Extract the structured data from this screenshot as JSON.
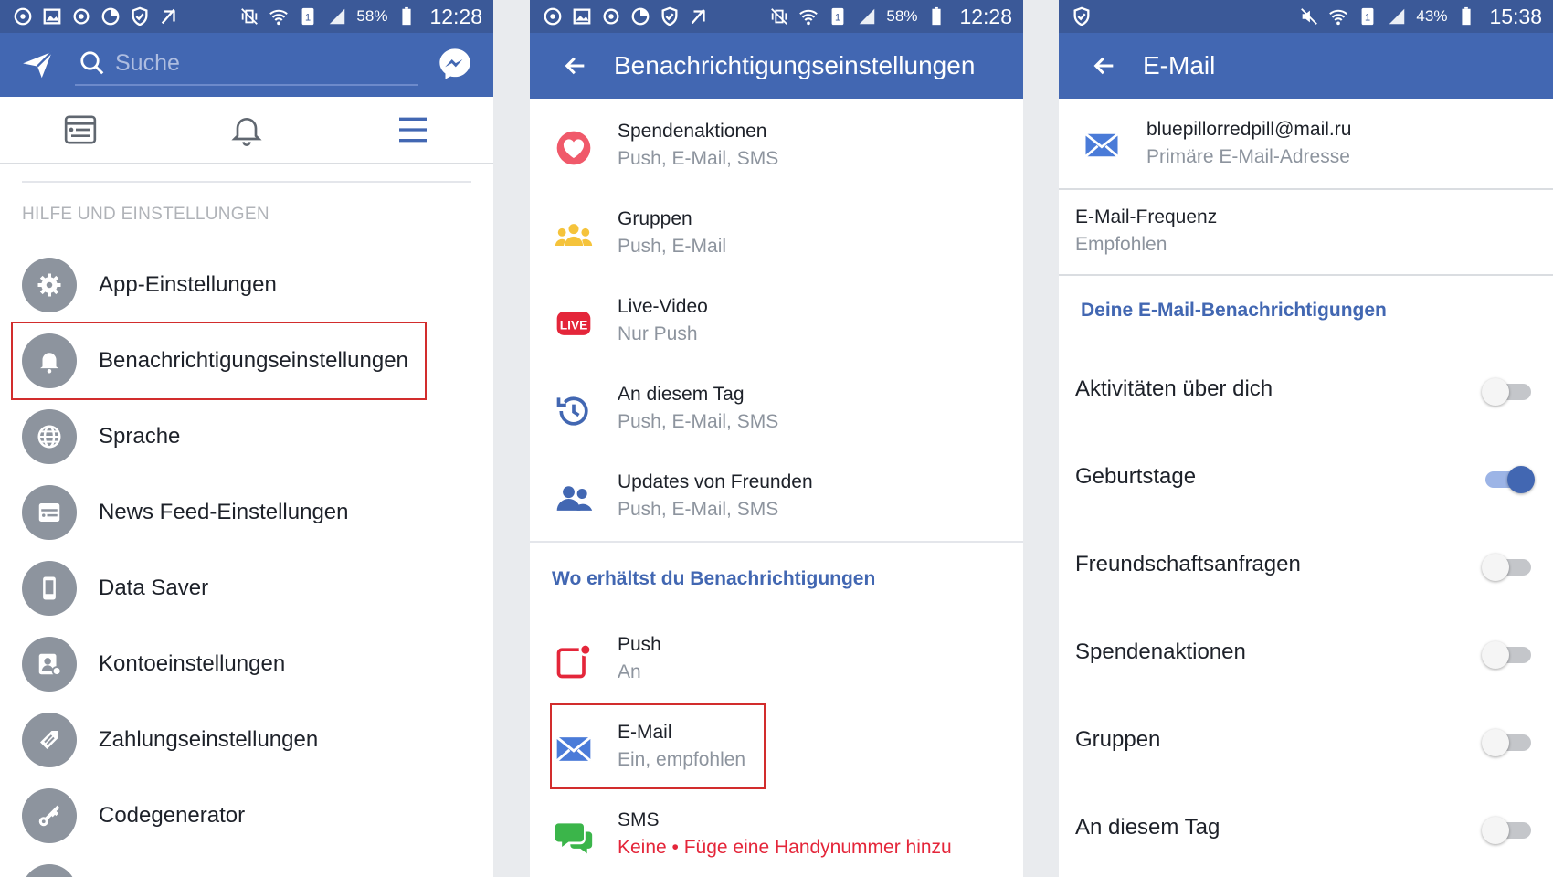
{
  "phone1": {
    "status": {
      "battery": "58%",
      "time": "12:28"
    },
    "search": {
      "placeholder": "Suche"
    },
    "section_label": "HILFE UND EINSTELLUNGEN",
    "menu": [
      {
        "label": "App-Einstellungen",
        "icon": "gear-icon"
      },
      {
        "label": "Benachrichtigungseinstellungen",
        "icon": "bell-icon"
      },
      {
        "label": "Sprache",
        "icon": "globe-icon"
      },
      {
        "label": "News Feed-Einstellungen",
        "icon": "newsfeed-icon"
      },
      {
        "label": "Data Saver",
        "icon": "phone-icon"
      },
      {
        "label": "Kontoeinstellungen",
        "icon": "account-gear-icon"
      },
      {
        "label": "Zahlungseinstellungen",
        "icon": "tag-icon"
      },
      {
        "label": "Codegenerator",
        "icon": "key-icon"
      }
    ]
  },
  "phone2": {
    "status": {
      "battery": "58%",
      "time": "12:28"
    },
    "title": "Benachrichtigungseinstellungen",
    "items": [
      {
        "title": "Spendenaktionen",
        "sub": "Push, E-Mail, SMS",
        "icon": "heart-icon"
      },
      {
        "title": "Gruppen",
        "sub": "Push, E-Mail",
        "icon": "group-icon"
      },
      {
        "title": "Live-Video",
        "sub": "Nur Push",
        "icon": "live-icon",
        "badge": "LIVE"
      },
      {
        "title": "An diesem Tag",
        "sub": "Push, E-Mail, SMS",
        "icon": "history-icon"
      },
      {
        "title": "Updates von Freunden",
        "sub": "Push, E-Mail, SMS",
        "icon": "friends-icon"
      }
    ],
    "section_label": "Wo erhältst du Benachrichtigungen",
    "channels": [
      {
        "title": "Push",
        "sub": "An",
        "icon": "push-icon"
      },
      {
        "title": "E-Mail",
        "sub": "Ein, empfohlen",
        "icon": "mail-icon"
      },
      {
        "title": "SMS",
        "sub": "Keine • Füge eine Handynummer hinzu",
        "icon": "sms-icon"
      }
    ],
    "colors": {
      "warning_text": "#e4263a"
    }
  },
  "phone3": {
    "status": {
      "battery": "43%",
      "time": "15:38"
    },
    "title": "E-Mail",
    "email": {
      "address": "bluepillorredpill@mail.ru",
      "label": "Primäre E-Mail-Adresse"
    },
    "frequency": {
      "label": "E-Mail-Frequenz",
      "value": "Empfohlen"
    },
    "section_label": "Deine E-Mail-Benachrichtigungen",
    "toggles": [
      {
        "label": "Aktivitäten über dich",
        "on": false
      },
      {
        "label": "Geburtstage",
        "on": true
      },
      {
        "label": "Freundschaftsanfragen",
        "on": false
      },
      {
        "label": "Spendenaktionen",
        "on": false
      },
      {
        "label": "Gruppen",
        "on": false
      },
      {
        "label": "An diesem Tag",
        "on": false
      }
    ]
  },
  "colors": {
    "brand": "#4267b2",
    "highlight": "#d22d2d"
  }
}
